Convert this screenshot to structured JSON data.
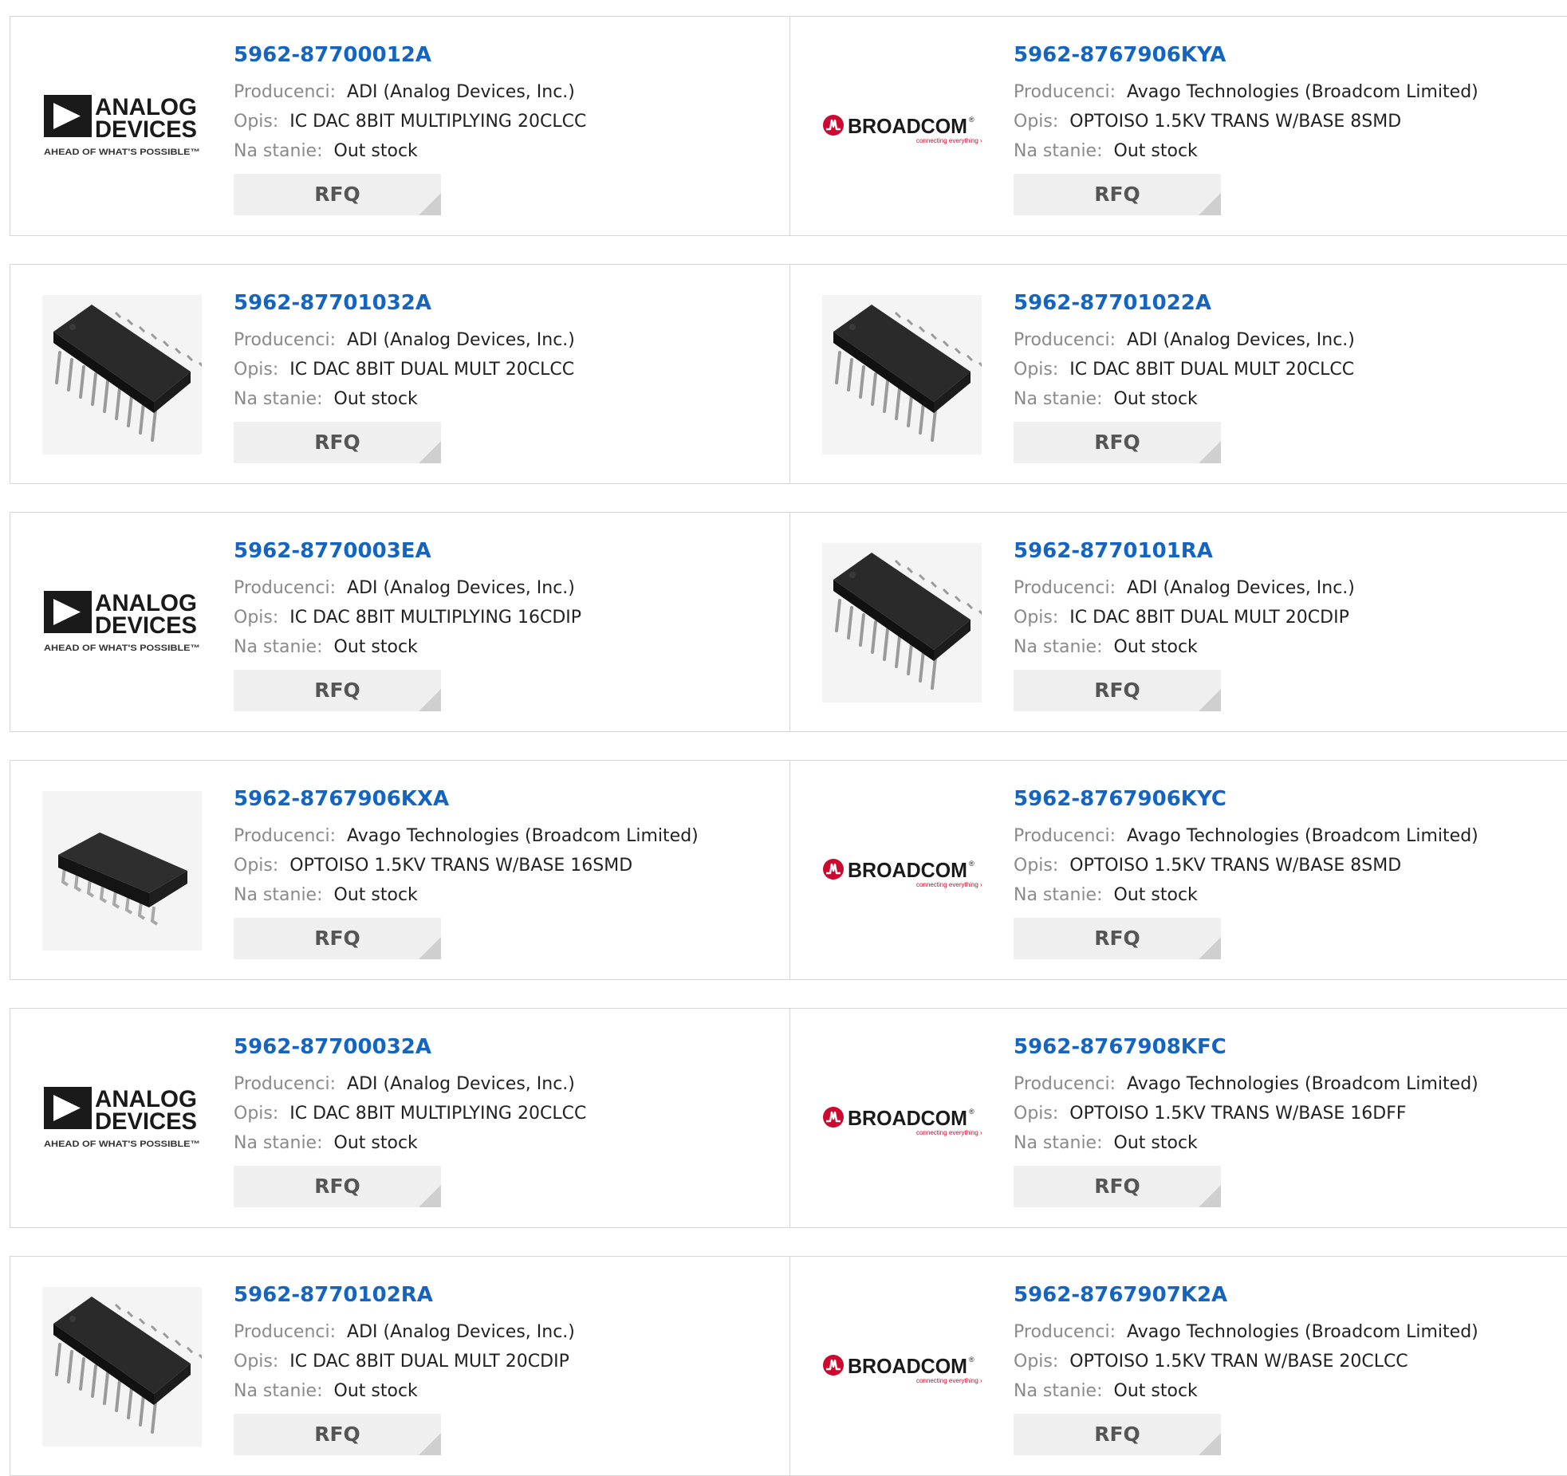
{
  "labels": {
    "manufacturer": "Producenci:",
    "description": "Opis:",
    "stock": "Na stanie:",
    "rfq": "RFQ"
  },
  "logos": {
    "analog": {
      "line1": "ANALOG",
      "line2": "DEVICES",
      "tagline": "AHEAD OF WHAT'S POSSIBLE™"
    },
    "broadcom": {
      "name": "BROADCOM",
      "mark": "®",
      "tagline": "connecting everything ›"
    }
  },
  "products": [
    {
      "part": "5962-87700012A",
      "manufacturer": "ADI (Analog Devices, Inc.)",
      "description": "IC DAC 8BIT MULTIPLYING 20CLCC",
      "stock": "Out stock",
      "image": "analog-devices-logo"
    },
    {
      "part": "5962-8767906KYA",
      "manufacturer": "Avago Technologies (Broadcom Limited)",
      "description": "OPTOISO 1.5KV TRANS W/BASE 8SMD",
      "stock": "Out stock",
      "image": "broadcom-logo"
    },
    {
      "part": "5962-87701032A",
      "manufacturer": "ADI (Analog Devices, Inc.)",
      "description": "IC DAC 8BIT DUAL MULT 20CLCC",
      "stock": "Out stock",
      "image": "dip-chip"
    },
    {
      "part": "5962-87701022A",
      "manufacturer": "ADI (Analog Devices, Inc.)",
      "description": "IC DAC 8BIT DUAL MULT 20CLCC",
      "stock": "Out stock",
      "image": "dip-chip"
    },
    {
      "part": "5962-8770003EA",
      "manufacturer": "ADI (Analog Devices, Inc.)",
      "description": "IC DAC 8BIT MULTIPLYING 16CDIP",
      "stock": "Out stock",
      "image": "analog-devices-logo"
    },
    {
      "part": "5962-8770101RA",
      "manufacturer": "ADI (Analog Devices, Inc.)",
      "description": "IC DAC 8BIT DUAL MULT 20CDIP",
      "stock": "Out stock",
      "image": "dip-chip"
    },
    {
      "part": "5962-8767906KXA",
      "manufacturer": "Avago Technologies (Broadcom Limited)",
      "description": "OPTOISO 1.5KV TRANS W/BASE 16SMD",
      "stock": "Out stock",
      "image": "smd-chip"
    },
    {
      "part": "5962-8767906KYC",
      "manufacturer": "Avago Technologies (Broadcom Limited)",
      "description": "OPTOISO 1.5KV TRANS W/BASE 8SMD",
      "stock": "Out stock",
      "image": "broadcom-logo"
    },
    {
      "part": "5962-87700032A",
      "manufacturer": "ADI (Analog Devices, Inc.)",
      "description": "IC DAC 8BIT MULTIPLYING 20CLCC",
      "stock": "Out stock",
      "image": "analog-devices-logo"
    },
    {
      "part": "5962-8767908KFC",
      "manufacturer": "Avago Technologies (Broadcom Limited)",
      "description": "OPTOISO 1.5KV TRANS W/BASE 16DFF",
      "stock": "Out stock",
      "image": "broadcom-logo"
    },
    {
      "part": "5962-8770102RA",
      "manufacturer": "ADI (Analog Devices, Inc.)",
      "description": "IC DAC 8BIT DUAL MULT 20CDIP",
      "stock": "Out stock",
      "image": "dip-chip"
    },
    {
      "part": "5962-8767907K2A",
      "manufacturer": "Avago Technologies (Broadcom Limited)",
      "description": "OPTOISO 1.5KV TRAN W/BASE 20CLCC",
      "stock": "Out stock",
      "image": "broadcom-logo"
    }
  ]
}
